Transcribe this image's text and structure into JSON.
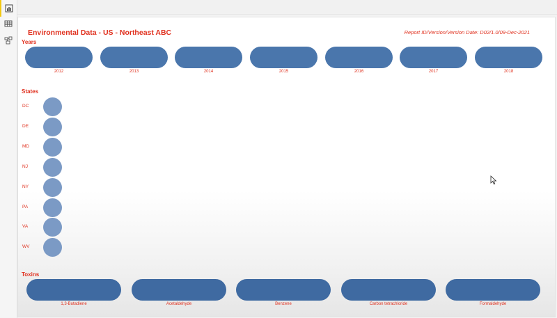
{
  "report": {
    "title": "Environmental Data - US - Northeast ABC",
    "id_line": "Report ID/Version/Version Date: D02/1.0/09-Dec-2021"
  },
  "sections": {
    "years": "Years",
    "states": "States",
    "toxins": "Toxins"
  },
  "years": [
    "2012",
    "2013",
    "2014",
    "2015",
    "2016",
    "2017",
    "2018"
  ],
  "states": [
    "DC",
    "DE",
    "MD",
    "NJ",
    "NY",
    "PA",
    "VA",
    "WV"
  ],
  "toxins": [
    "1,3-Butadiene",
    "Acetaldehyde",
    "Benzene",
    "Carbon tetrachloride",
    "Formaldehyde"
  ],
  "colors": {
    "accent": "#e0301e",
    "year_pill": "#4a76ac",
    "state_circle": "#7b9ac5",
    "toxin_pill": "#3f6aa1",
    "active_view_marker": "#f2c811"
  },
  "icons": {
    "rail": [
      "report-view-icon",
      "data-view-icon",
      "model-view-icon"
    ]
  }
}
